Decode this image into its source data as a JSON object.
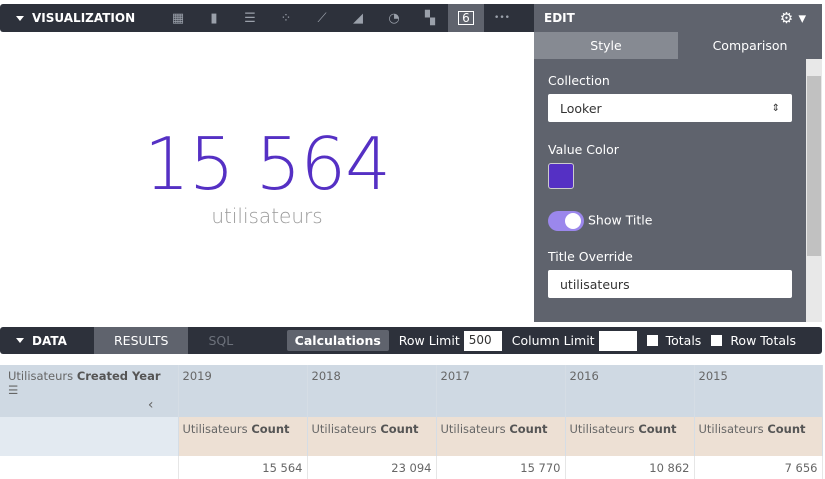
{
  "viz": {
    "title": "VISUALIZATION",
    "icons": [
      "table-icon",
      "column-chart-icon",
      "bar-chart-icon",
      "scatter-icon",
      "line-chart-icon",
      "area-chart-icon",
      "pie-chart-icon",
      "map-icon",
      "single-value-icon",
      "more-icon"
    ],
    "single_value_glyph": "6",
    "more": "•••"
  },
  "value": {
    "number": "15 564",
    "title": "utilisateurs",
    "color": "#5530c4"
  },
  "edit": {
    "title": "EDIT",
    "tabs": [
      "Style",
      "Comparison"
    ],
    "collection_label": "Collection",
    "collection_value": "Looker",
    "value_color_label": "Value Color",
    "show_title_label": "Show Title",
    "show_title": true,
    "title_override_label": "Title Override",
    "title_override_value": "utilisateurs"
  },
  "data": {
    "title": "DATA",
    "tabs": [
      "RESULTS",
      "SQL"
    ],
    "calculations": "Calculations",
    "row_limit_label": "Row Limit",
    "row_limit": "500",
    "column_limit_label": "Column Limit",
    "column_limit": "",
    "totals_label": "Totals",
    "row_totals_label": "Row Totals"
  },
  "table": {
    "pivot_dim_prefix": "Utilisateurs",
    "pivot_dim": "Created Year",
    "years": [
      "2019",
      "2018",
      "2017",
      "2016",
      "2015"
    ],
    "measure_prefix": "Utilisateurs",
    "measure": "Count",
    "values": [
      "15 564",
      "23 094",
      "15 770",
      "10 862",
      "7 656"
    ]
  }
}
